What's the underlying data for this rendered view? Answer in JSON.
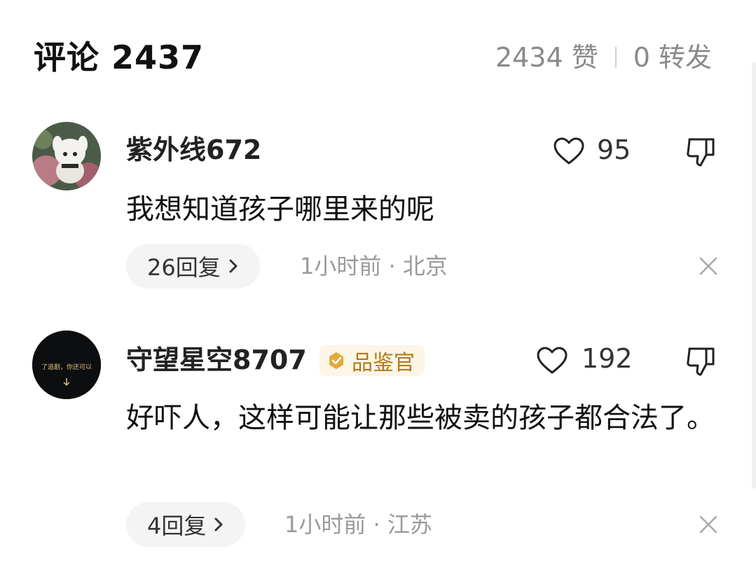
{
  "header": {
    "title": "评论 2437",
    "likes": "2434 赞",
    "shares": "0 转发"
  },
  "comments": [
    {
      "username": "紫外线672",
      "likes": "95",
      "content": "我想知道孩子哪里来的呢",
      "replies_label": "26回复",
      "meta": "1小时前 · 北京"
    },
    {
      "username": "守望星空8707",
      "badge": "品鉴官",
      "avatar_text": "了追剧，你还可以",
      "likes": "192",
      "content": "好吓人，这样可能让那些被卖的孩子都合法了。",
      "replies_label": "4回复",
      "meta": "1小时前 · 江苏"
    }
  ],
  "colors": {
    "badge_bg": "#fdf5e6",
    "badge_text": "#b07a1c",
    "muted_text": "#9a9a9a",
    "pill_bg": "#f4f4f4"
  }
}
